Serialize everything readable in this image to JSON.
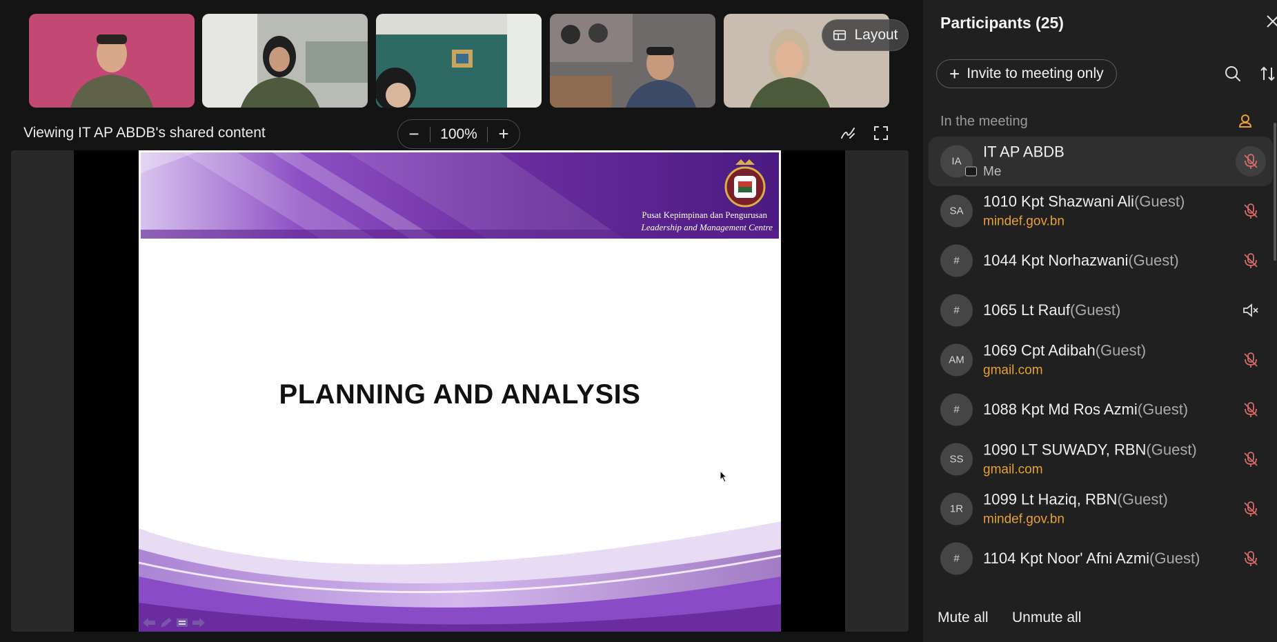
{
  "video_strip": {
    "layout_label": "Layout",
    "tiles": [
      {
        "bg": "#c94f78"
      },
      {
        "bg": "#b9bcb5"
      },
      {
        "bg": "#2e6a63"
      },
      {
        "bg": "#6f6a6a"
      },
      {
        "bg": "#c8bdb0"
      }
    ]
  },
  "share": {
    "viewing_label": "Viewing IT AP ABDB's shared content",
    "zoom": "100%",
    "zoom_out_label": "−",
    "zoom_in_label": "+"
  },
  "slide": {
    "org_name_ms": "Pusat Kepimpinan dan Pengurusan",
    "org_name_en": "Leadership and Management Centre",
    "title": "PLANNING AND ANALYSIS"
  },
  "panel": {
    "title": "Participants (25)",
    "invite_label": "Invite to meeting only",
    "section_label": "In the meeting",
    "mute_all_label": "Mute all",
    "unmute_all_label": "Unmute all",
    "participants": [
      {
        "initials": "IA",
        "name": "IT AP ABDB",
        "guest": "",
        "sub": "Me",
        "mic": "muted",
        "me": true
      },
      {
        "initials": "SA",
        "name": "1010 Kpt Shazwani Ali",
        "guest": "(Guest)",
        "sub": "mindef.gov.bn",
        "mic": "muted"
      },
      {
        "initials": "#",
        "name": "1044 Kpt Norhazwani",
        "guest": "(Guest)",
        "sub": "",
        "mic": "muted"
      },
      {
        "initials": "#",
        "name": "1065 Lt Rauf",
        "guest": "(Guest)",
        "sub": "",
        "mic": "speaker-off"
      },
      {
        "initials": "AM",
        "name": "1069 Cpt Adibah",
        "guest": "(Guest)",
        "sub": "gmail.com",
        "mic": "muted"
      },
      {
        "initials": "#",
        "name": "1088 Kpt Md Ros Azmi",
        "guest": "(Guest)",
        "sub": "",
        "mic": "muted"
      },
      {
        "initials": "SS",
        "name": "1090 LT SUWADY, RBN",
        "guest": "(Guest)",
        "sub": "gmail.com",
        "mic": "muted"
      },
      {
        "initials": "1R",
        "name": "1099 Lt Haziq, RBN",
        "guest": "(Guest)",
        "sub": "mindef.gov.bn",
        "mic": "muted"
      },
      {
        "initials": "#",
        "name": "1104 Kpt Noor' Afni Azmi",
        "guest": "(Guest)",
        "sub": "",
        "mic": "muted"
      }
    ]
  },
  "colors": {
    "accent_orange": "#e8a030",
    "muted_red": "#d96a6a",
    "slide_purple": "#6a2c9e"
  }
}
